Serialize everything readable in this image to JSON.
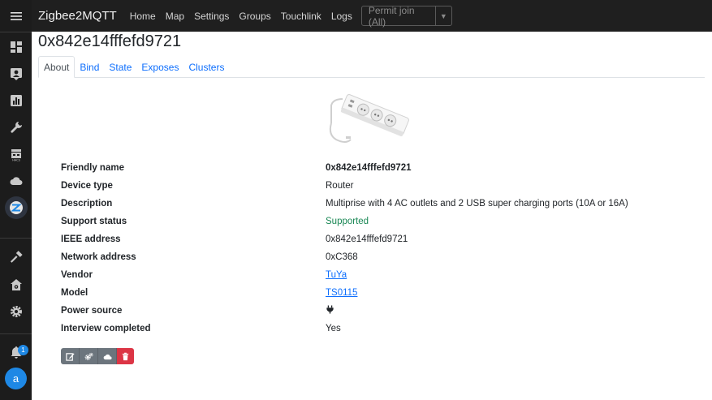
{
  "navbar": {
    "brand": "Zigbee2MQTT",
    "links": [
      "Home",
      "Map",
      "Settings",
      "Groups",
      "Touchlink",
      "Logs"
    ],
    "permit_join": "Permit join (All)"
  },
  "sidebar": {
    "icons": [
      "menu-icon",
      "dashboard-icon",
      "person-icon",
      "chart-icon",
      "wrench-icon",
      "hacs-icon",
      "cloud-icon",
      "zigbee-icon",
      "hammer-icon",
      "home-gear-icon",
      "gear-icon",
      "bell-icon"
    ],
    "notification_count": "1",
    "avatar_letter": "a"
  },
  "device": {
    "title": "0x842e14fffefd9721"
  },
  "tabs": [
    "About",
    "Bind",
    "State",
    "Exposes",
    "Clusters"
  ],
  "info": [
    {
      "key": "Friendly name",
      "value": "0x842e14fffefd9721"
    },
    {
      "key": "Device type",
      "value": "Router"
    },
    {
      "key": "Description",
      "value": "Multiprise with 4 AC outlets and 2 USB super charging ports (10A or 16A)"
    },
    {
      "key": "Support status",
      "value": "Supported"
    },
    {
      "key": "IEEE address",
      "value": "0x842e14fffefd9721"
    },
    {
      "key": "Network address",
      "value": "0xC368"
    },
    {
      "key": "Vendor",
      "value": "TuYa"
    },
    {
      "key": "Model",
      "value": "TS0115"
    },
    {
      "key": "Power source",
      "value": ""
    },
    {
      "key": "Interview completed",
      "value": "Yes"
    }
  ],
  "colors": {
    "accent": "#0d6efd",
    "success": "#198754",
    "danger": "#dc3545",
    "sidebar": "#1c1c1c"
  }
}
